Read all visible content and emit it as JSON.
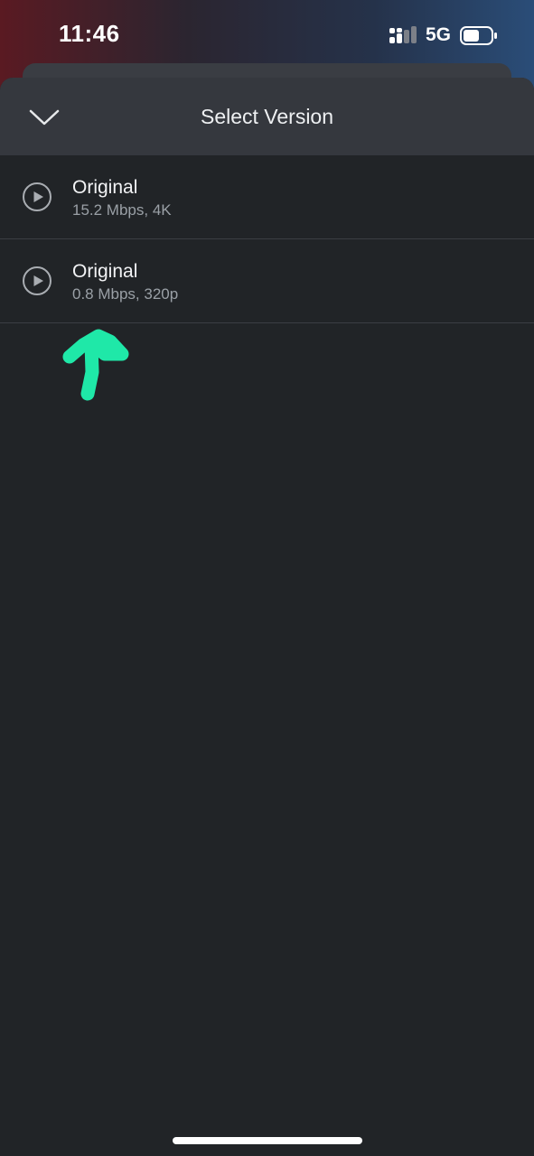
{
  "status_bar": {
    "time": "11:46",
    "network": "5G",
    "signal_icon": "cellular-signal-icon",
    "battery_icon": "battery-icon"
  },
  "sheet": {
    "title": "Select Version",
    "collapse_icon": "chevron-down-icon"
  },
  "versions": [
    {
      "name": "Original",
      "detail": "15.2 Mbps, 4K",
      "icon": "play-icon"
    },
    {
      "name": "Original",
      "detail": "0.8 Mbps, 320p",
      "icon": "play-icon"
    }
  ],
  "annotation": {
    "icon": "hand-drawn-arrow-up-icon",
    "color": "#1fe8a8"
  },
  "colors": {
    "sheet_background": "#212427",
    "header_background": "#35383e",
    "secondary_text": "#9aa0a6"
  }
}
